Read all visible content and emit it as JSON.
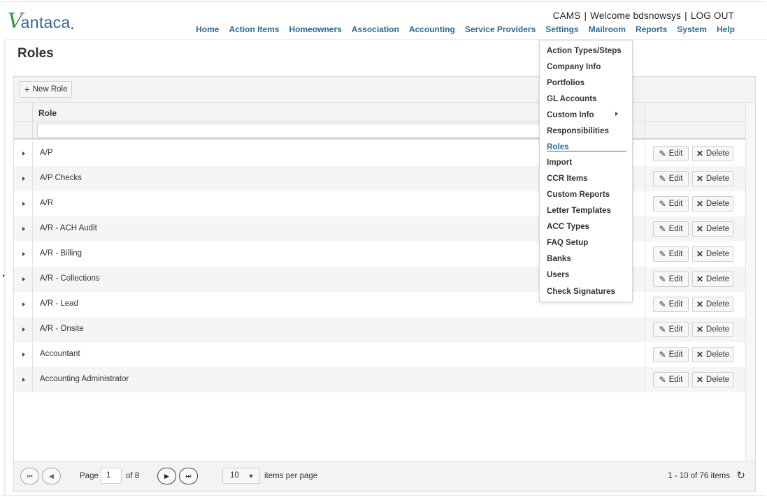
{
  "brand": {
    "logo_first": "V",
    "logo_rest": "antaca"
  },
  "userbar": {
    "app": "CAMS",
    "welcome": "Welcome bdsnowsys",
    "logout": "LOG OUT"
  },
  "nav": [
    "Home",
    "Action Items",
    "Homeowners",
    "Association",
    "Accounting",
    "Service Providers",
    "Settings",
    "Mailroom",
    "Reports",
    "System",
    "Help"
  ],
  "page": {
    "title": "Roles"
  },
  "toolbar": {
    "new_role": "New Role"
  },
  "grid": {
    "column_role": "Role",
    "filter_value": "",
    "edit_label": "Edit",
    "delete_label": "Delete",
    "rows": [
      "A/P",
      "A/P Checks",
      "A/R",
      "A/R - ACH Audit",
      "A/R - Billing",
      "A/R - Collections",
      "A/R - Lead",
      "A/R - Onsite",
      "Accountant",
      "Accounting Administrator"
    ]
  },
  "pager": {
    "page_label": "Page",
    "page_value": "1",
    "of_label": "of 8",
    "page_size": "10",
    "items_per_page": "items per page",
    "info": "1 - 10 of 76 items"
  },
  "settings_menu": {
    "items": [
      "Action Types/Steps",
      "Company Info",
      "Portfolios",
      "GL Accounts",
      "Custom Info",
      "Responsibilities",
      "Roles",
      "Import",
      "CCR Items",
      "Custom Reports",
      "Letter Templates",
      "ACC Types",
      "FAQ Setup",
      "Banks",
      "Users",
      "Check Signatures"
    ],
    "active": "Roles"
  },
  "colors": {
    "brand_green": "#3c9b3a",
    "link_blue": "#2b6a99"
  }
}
